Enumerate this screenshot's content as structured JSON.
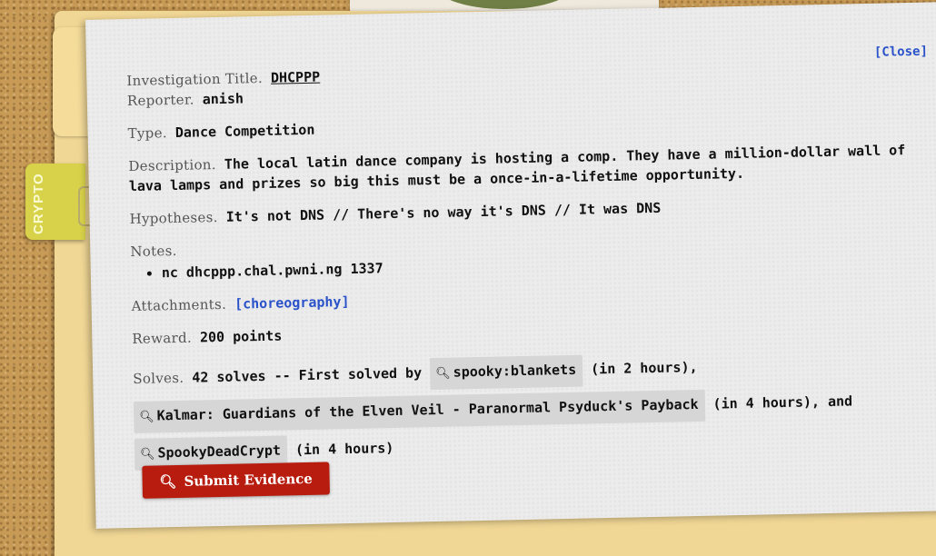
{
  "category_tab": {
    "label": "CRYPTO"
  },
  "close_label": "[Close]",
  "fields": {
    "title_label": "Investigation Title.",
    "title_value": "DHCPPP",
    "reporter_label": "Reporter.",
    "reporter_value": "anish",
    "type_label": "Type.",
    "type_value": "Dance Competition",
    "description_label": "Description.",
    "description_value": "The local latin dance company is hosting a comp. They have a million-dollar wall of lava lamps and prizes so big this must be a once-in-a-lifetime opportunity.",
    "hypotheses_label": "Hypotheses.",
    "hypotheses_value": "It's not DNS // There's no way it's DNS // It was DNS",
    "notes_label": "Notes.",
    "notes_items": [
      "nc dhcppp.chal.pwni.ng 1337"
    ],
    "attachments_label": "Attachments.",
    "attachment_link": "[choreography]",
    "reward_label": "Reward.",
    "reward_value": "200 points",
    "solves_label": "Solves.",
    "solves_prefix": "42 solves -- First solved by",
    "solvers": [
      {
        "name": "spooky:blankets",
        "time": "(in 2 hours),",
        "icon": "search-icon"
      },
      {
        "name": "Kalmar: Guardians of the Elven Veil - Paranormal Psyduck's Payback",
        "time": "(in 4 hours), and",
        "icon": "search-icon"
      },
      {
        "name": "SpookyDeadCrypt",
        "time": "(in 4 hours)",
        "icon": "search-icon"
      }
    ]
  },
  "submit_label": "Submit Evidence",
  "colors": {
    "link": "#2a52c9",
    "submit": "#b81c0f",
    "tab": "#d8d24a",
    "folder": "#f1d795"
  }
}
